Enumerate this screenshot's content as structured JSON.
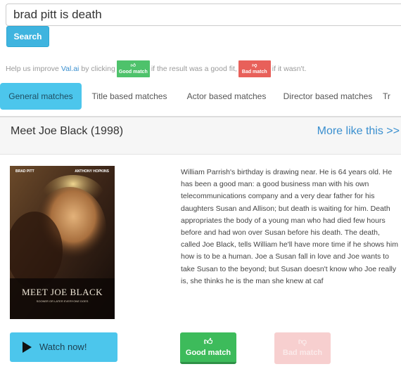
{
  "search": {
    "query": "brad pitt is death",
    "button_label": "Search"
  },
  "help": {
    "prefix": "Help us improve",
    "link": "Val.ai",
    "by_clicking": "by clicking",
    "good_badge": "Good match",
    "middle": "if the result was a good fit,",
    "bad_badge": "Bad match",
    "suffix": "if it wasn't."
  },
  "tabs": [
    {
      "label": "General matches",
      "active": true
    },
    {
      "label": "Title based matches",
      "active": false
    },
    {
      "label": "Actor based matches",
      "active": false
    },
    {
      "label": "Director based matches",
      "active": false
    },
    {
      "label": "Tr",
      "active": false
    }
  ],
  "result": {
    "title": "Meet Joe Black (1998)",
    "more_link": "More like this >>",
    "poster": {
      "actor_left": "BRAD PITT",
      "actor_right": "ANTHONY HOPKINS",
      "title": "MEET JOE BLACK",
      "tagline": "SOONER OR LATER EVERYONE DOES"
    },
    "synopsis": "William Parrish's birthday is drawing near. He is 64 years old. He has been a good man: a good business man with his own telecommunications company and a very dear father for his daughters Susan and Allison; but death is waiting for him. Death appropriates the body of a young man who had died few hours before and had won over Susan before his death. The death, called Joe Black, tells William he'll have more time if he shows him how is to be a human. Joe a Susan fall in love and Joe wants to take Susan to the beyond; but Susan doesn't know who Joe really is, she thinks he is the man she knew at caf",
    "watch_label": "Watch now!",
    "good_label": "Good match",
    "bad_label": "Bad match"
  },
  "icons": {
    "play": "play-icon",
    "thumbs_up": "thumbs-up-icon",
    "thumbs_down": "thumbs-down-icon"
  },
  "colors": {
    "accent": "#4cc6ec",
    "search_button": "#3fb4df",
    "good": "#3dbb5b",
    "bad": "#e8605a",
    "link": "#3a8fcf"
  }
}
